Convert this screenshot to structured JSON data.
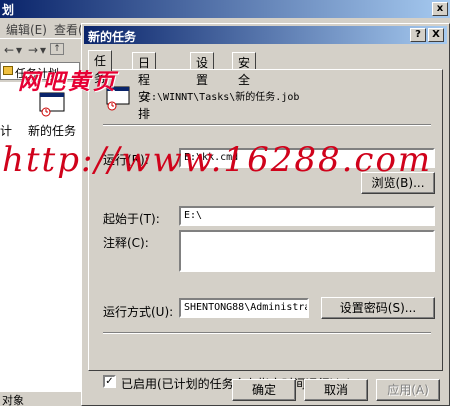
{
  "background_window": {
    "title": "划",
    "menu": [
      "编辑(E)",
      "查看(V)"
    ],
    "address_text": "任务计划",
    "list_item_label": "新的任务",
    "list_item_left_label": "计",
    "status_text": "对象"
  },
  "dialog": {
    "title": "新的任务",
    "help_glyph": "?",
    "close_glyph": "X",
    "tabs": [
      "任务",
      "日程安排",
      "设置",
      "安全"
    ],
    "task_path": "C:\\WINNT\\Tasks\\新的任务.job",
    "run_label": "运行(R):",
    "run_value": "E:\\kk.cmd",
    "browse_label": "浏览(B)...",
    "start_in_label": "起始于(T):",
    "start_in_value": "E:\\",
    "comment_label": "注释(C):",
    "comment_value": "",
    "run_as_label": "运行方式(U):",
    "run_as_value": "SHENTONG88\\Administrat",
    "set_password_label": "设置密码(S)...",
    "enabled_checked": true,
    "enabled_label": "已启用(已计划的任务会在指定时间运行)(E)",
    "ok_label": "确定",
    "cancel_label": "取消",
    "apply_label": "应用(A)"
  },
  "watermark": {
    "logo": "网吧黄页",
    "url": "http://www.16288.com"
  },
  "colors": {
    "titlebar_start": "#0a246a",
    "titlebar_end": "#a6caf0",
    "face": "#d4d0c8",
    "watermark": "#e60033"
  }
}
